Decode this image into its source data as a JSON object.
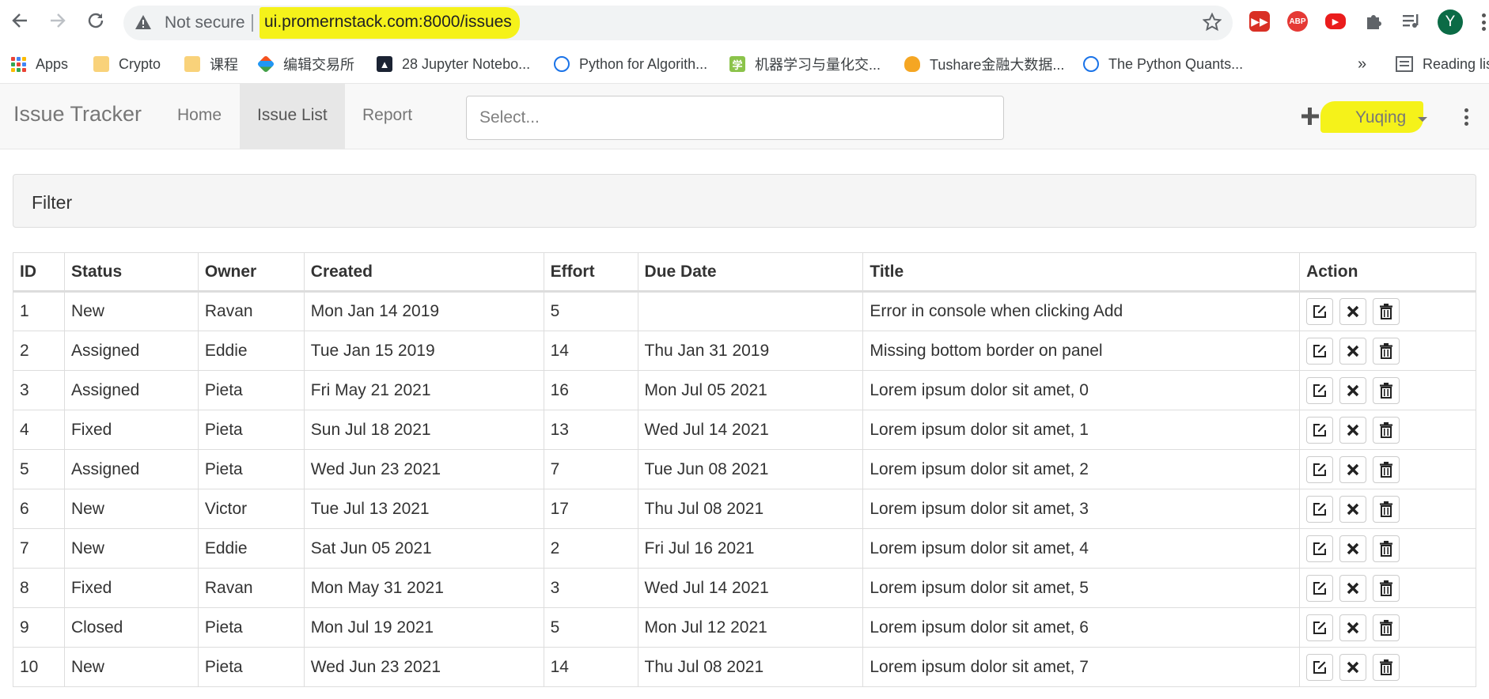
{
  "browser": {
    "security_label": "Not secure",
    "url": "ui.promernstack.com:8000/issues",
    "avatar_letter": "Y",
    "extensions": [
      "video-speed-icon",
      "adblock-plus-icon",
      "youtube-icon",
      "extensions-puzzle-icon",
      "media-queue-icon"
    ]
  },
  "bookmarks": {
    "items": [
      {
        "label": "Apps",
        "icon": "apps-grid-icon"
      },
      {
        "label": "Crypto",
        "icon": "folder-icon"
      },
      {
        "label": "课程",
        "icon": "folder-icon"
      },
      {
        "label": "编辑交易所",
        "icon": "bookmark-site-icon"
      },
      {
        "label": "28 Jupyter Notebo...",
        "icon": "bookmark-site-icon"
      },
      {
        "label": "Python for Algorith...",
        "icon": "bookmark-site-icon"
      },
      {
        "label": "机器学习与量化交...",
        "icon": "bookmark-site-icon"
      },
      {
        "label": "Tushare金融大数据...",
        "icon": "bookmark-site-icon"
      },
      {
        "label": "The Python Quants...",
        "icon": "bookmark-site-icon"
      }
    ],
    "overflow": "»",
    "reading_list": "Reading list",
    "icon_glyph_learn": "学"
  },
  "app": {
    "brand": "Issue Tracker",
    "nav": [
      {
        "label": "Home",
        "active": false
      },
      {
        "label": "Issue List",
        "active": true
      },
      {
        "label": "Report",
        "active": false
      }
    ],
    "search_placeholder": "Select...",
    "user_name": "Yuqing"
  },
  "filter": {
    "title": "Filter"
  },
  "table": {
    "headers": [
      "ID",
      "Status",
      "Owner",
      "Created",
      "Effort",
      "Due Date",
      "Title",
      "Action"
    ],
    "rows": [
      {
        "id": "1",
        "status": "New",
        "owner": "Ravan",
        "created": "Mon Jan 14 2019",
        "effort": "5",
        "due": "",
        "title": "Error in console when clicking Add"
      },
      {
        "id": "2",
        "status": "Assigned",
        "owner": "Eddie",
        "created": "Tue Jan 15 2019",
        "effort": "14",
        "due": "Thu Jan 31 2019",
        "title": "Missing bottom border on panel"
      },
      {
        "id": "3",
        "status": "Assigned",
        "owner": "Pieta",
        "created": "Fri May 21 2021",
        "effort": "16",
        "due": "Mon Jul 05 2021",
        "title": "Lorem ipsum dolor sit amet, 0"
      },
      {
        "id": "4",
        "status": "Fixed",
        "owner": "Pieta",
        "created": "Sun Jul 18 2021",
        "effort": "13",
        "due": "Wed Jul 14 2021",
        "title": "Lorem ipsum dolor sit amet, 1"
      },
      {
        "id": "5",
        "status": "Assigned",
        "owner": "Pieta",
        "created": "Wed Jun 23 2021",
        "effort": "7",
        "due": "Tue Jun 08 2021",
        "title": "Lorem ipsum dolor sit amet, 2"
      },
      {
        "id": "6",
        "status": "New",
        "owner": "Victor",
        "created": "Tue Jul 13 2021",
        "effort": "17",
        "due": "Thu Jul 08 2021",
        "title": "Lorem ipsum dolor sit amet, 3"
      },
      {
        "id": "7",
        "status": "New",
        "owner": "Eddie",
        "created": "Sat Jun 05 2021",
        "effort": "2",
        "due": "Fri Jul 16 2021",
        "title": "Lorem ipsum dolor sit amet, 4"
      },
      {
        "id": "8",
        "status": "Fixed",
        "owner": "Ravan",
        "created": "Mon May 31 2021",
        "effort": "3",
        "due": "Wed Jul 14 2021",
        "title": "Lorem ipsum dolor sit amet, 5"
      },
      {
        "id": "9",
        "status": "Closed",
        "owner": "Pieta",
        "created": "Mon Jul 19 2021",
        "effort": "5",
        "due": "Mon Jul 12 2021",
        "title": "Lorem ipsum dolor sit amet, 6"
      },
      {
        "id": "10",
        "status": "New",
        "owner": "Pieta",
        "created": "Wed Jun 23 2021",
        "effort": "14",
        "due": "Thu Jul 08 2021",
        "title": "Lorem ipsum dolor sit amet, 7"
      }
    ],
    "row_actions": [
      "edit-icon",
      "close-icon",
      "trash-icon"
    ]
  },
  "colors": {
    "highlight": "#f5f21a",
    "navbar_bg": "#f8f8f8",
    "active_tab_bg": "#e7e7e7",
    "avatar_bg": "#0b6b46"
  }
}
